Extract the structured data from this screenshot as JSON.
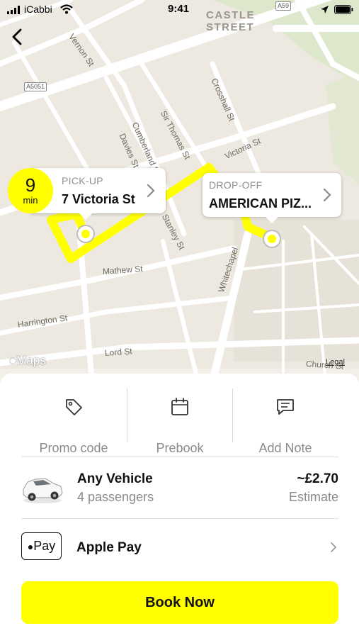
{
  "status_bar": {
    "carrier": "iCabbi",
    "time": "9:41"
  },
  "map": {
    "district": "CASTLE\nSTREET",
    "streets": [
      "Vernon St",
      "Crosshall St",
      "Sir Thomas St",
      "Cumberland St",
      "Davies St",
      "Victoria St",
      "Stanley St",
      "Whitechapel",
      "Mathew St",
      "Harrington St",
      "Lord St",
      "Church St"
    ],
    "road_signs": [
      "A5051",
      "A59"
    ],
    "attribution": "Maps",
    "legal": "Legal",
    "route_color": "#ffff00"
  },
  "eta": {
    "value": "9",
    "unit": "min"
  },
  "pickup": {
    "label": "PICK-UP",
    "address": "7 Victoria St"
  },
  "dropoff": {
    "label": "DROP-OFF",
    "address": "AMERICAN PIZ..."
  },
  "actions": [
    {
      "label": "Promo code",
      "icon": "tag-icon"
    },
    {
      "label": "Prebook",
      "icon": "calendar-icon"
    },
    {
      "label": "Add Note",
      "icon": "message-icon"
    }
  ],
  "vehicle": {
    "name": "Any Vehicle",
    "passengers": "4 passengers",
    "price": "~£2.70",
    "price_note": "Estimate"
  },
  "payment": {
    "logo_text": "Pay",
    "method": "Apple Pay"
  },
  "book_button": "Book Now",
  "colors": {
    "accent": "#ffff00",
    "map_bg": "#ede9e0"
  }
}
